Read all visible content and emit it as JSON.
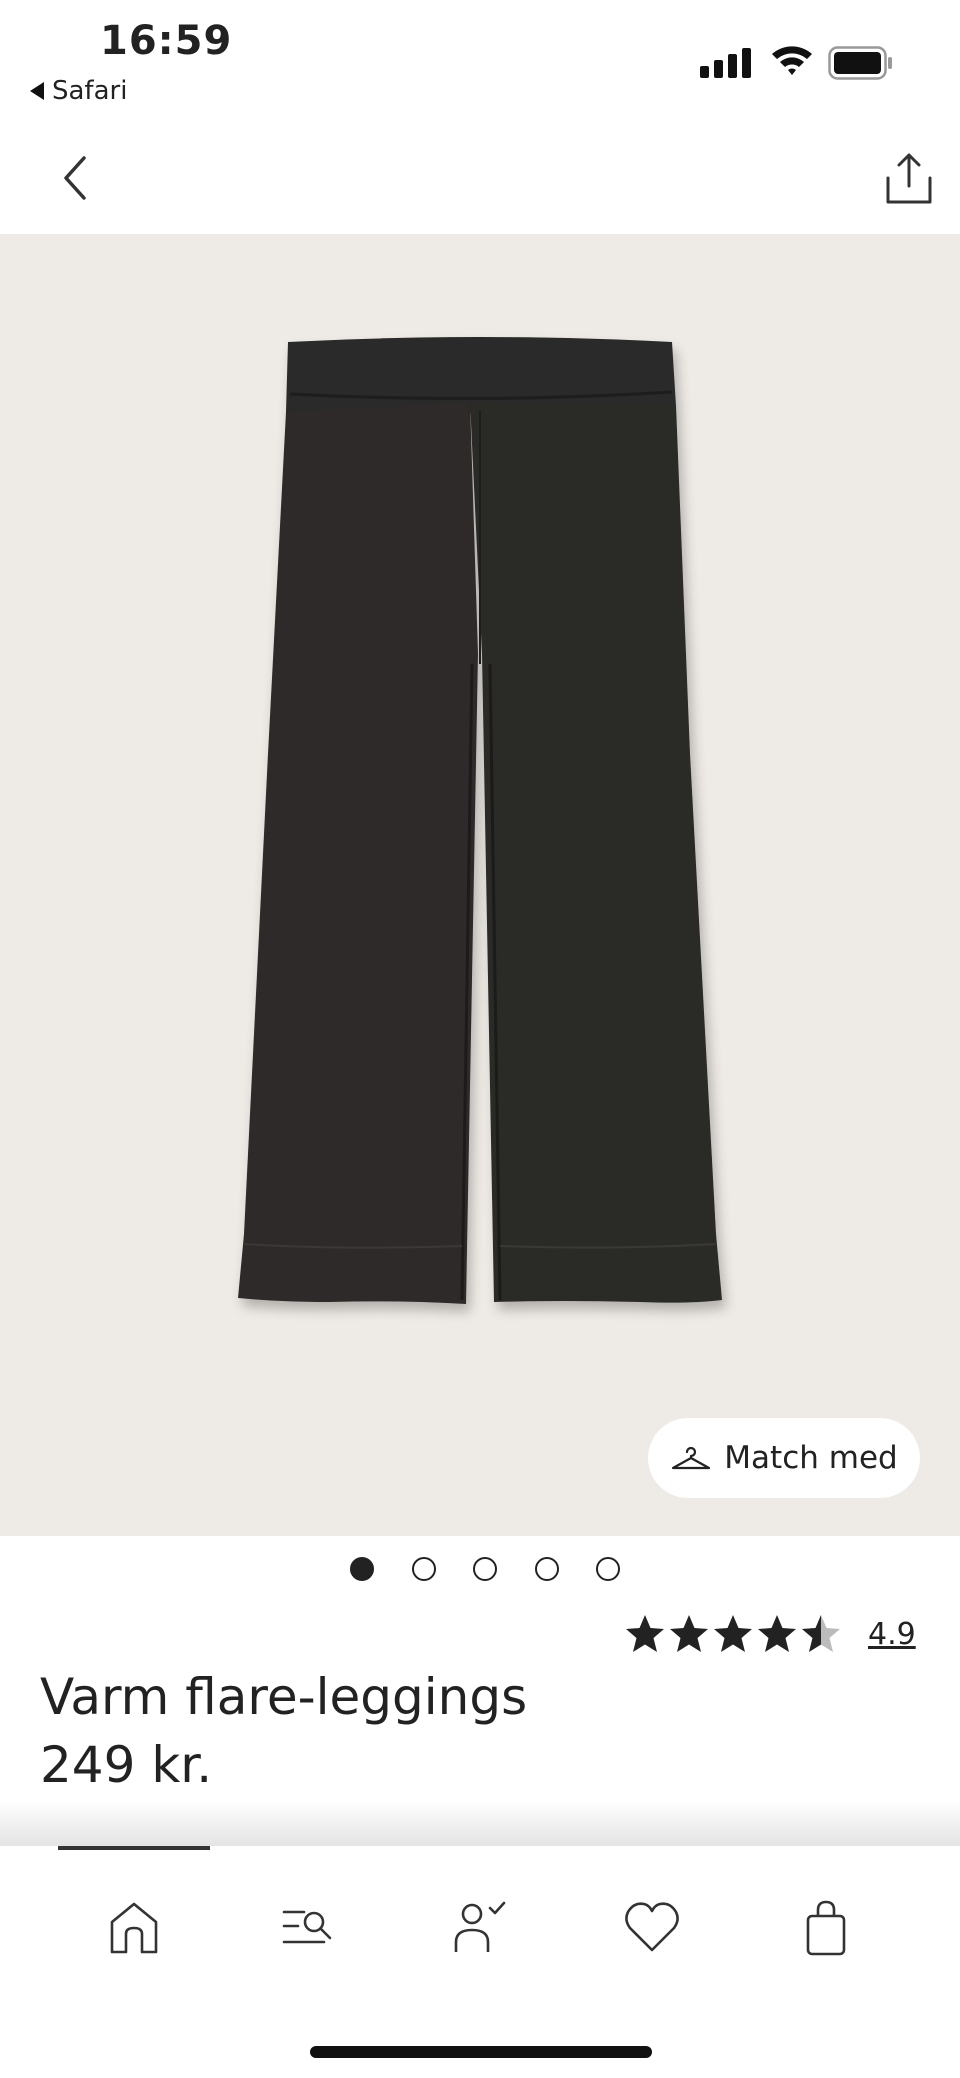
{
  "status_bar": {
    "time": "16:59",
    "back_app": "Safari"
  },
  "nav": {
    "back_icon": "chevron-left-icon",
    "share_icon": "share-icon"
  },
  "product": {
    "image_icon": "black-flare-leggings-photo",
    "match_button_label": "Match med",
    "image_count": 5,
    "active_image_index": 0,
    "rating_value": "4.9",
    "rating_stars": 4.5,
    "title": "Varm flare-leggings",
    "price": "249 kr."
  },
  "tab_bar": {
    "items": [
      {
        "icon": "home-icon"
      },
      {
        "icon": "search-icon"
      },
      {
        "icon": "account-icon"
      },
      {
        "icon": "heart-icon"
      },
      {
        "icon": "shopping-bag-icon"
      }
    ],
    "active_index": 0
  },
  "colors": {
    "image_background": "#eeeae5",
    "product": "#2b2a29",
    "text": "#222222"
  }
}
